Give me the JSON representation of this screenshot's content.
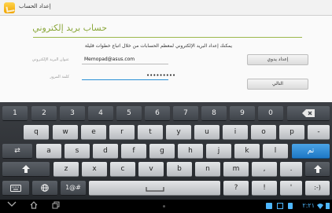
{
  "topbar": {
    "title": "إعداد الحساب"
  },
  "content": {
    "heading": "حساب بريد إلكتروني",
    "intro": "يمكنك إعداد البريد الإلكتروني لمعظم الحسابات من خلال اتباع خطوات قليلة",
    "email_label": "عنوان البريد الإلكتروني",
    "email_value": "Memopad@asus.com",
    "password_label": "كلمة المرور",
    "password_value": "•••••••••",
    "manual_setup_button": "إعداد يدوي",
    "next_button": "التالي"
  },
  "keyboard": {
    "row1": [
      "1",
      "2",
      "3",
      "4",
      "5",
      "6",
      "7",
      "8",
      "9",
      "0"
    ],
    "row2": [
      "q",
      "w",
      "e",
      "r",
      "t",
      "y",
      "u",
      "i",
      "o",
      "p",
      "-"
    ],
    "row3": [
      "a",
      "s",
      "d",
      "f",
      "g",
      "h",
      "j",
      "k",
      "l"
    ],
    "row3_tab": "⇄",
    "row3_enter": "تم",
    "row4": [
      "z",
      "x",
      "c",
      "v",
      "b",
      "n",
      "m",
      ",",
      "."
    ],
    "row5": {
      "sym": "1@#",
      "question": "?",
      "excl": "!",
      "apos": "'",
      "smiley": ":-)"
    }
  },
  "navbar": {
    "clock": "٢:٢١"
  },
  "colors": {
    "accent_green": "#8aa73a",
    "field_active": "#2a8fd6",
    "key_blue": "#1e78c5"
  }
}
